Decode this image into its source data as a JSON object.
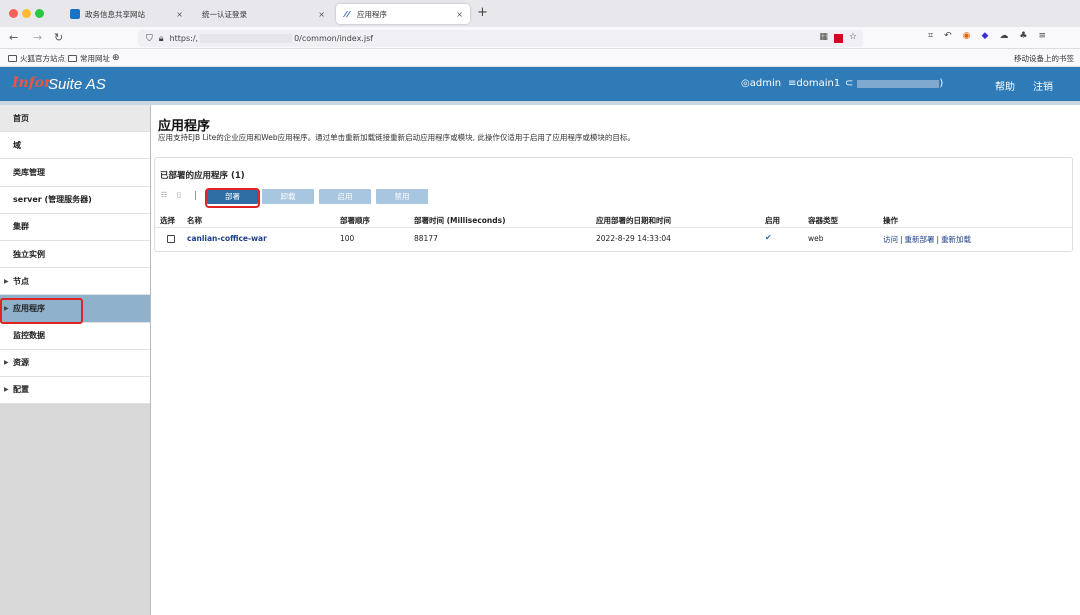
{
  "browser": {
    "tabs": [
      {
        "title": "政务信息共享网站",
        "close": "×"
      },
      {
        "title": "统一认证登录",
        "close": "×"
      },
      {
        "title": "应用程序",
        "close": "×"
      }
    ],
    "new_tab": "+",
    "url_prefix": "https:/,",
    "url_suffix": "0/common/index.jsf",
    "bookmarks": [
      "火狐官方站点",
      "常用网址"
    ],
    "mobile_bookmarks": "移动设备上的书签"
  },
  "header": {
    "logo_infor": "Infor",
    "logo_suite": "Suite AS",
    "user": "admin",
    "domain": "domain1",
    "ip_suffix": ")",
    "help": "帮助",
    "logout": "注销"
  },
  "sidebar": {
    "items": [
      {
        "label": "首页",
        "arrow": false
      },
      {
        "label": "域",
        "arrow": false
      },
      {
        "label": "类库管理",
        "arrow": false
      },
      {
        "label": "server (管理服务器)",
        "arrow": false
      },
      {
        "label": "集群",
        "arrow": false
      },
      {
        "label": "独立实例",
        "arrow": false
      },
      {
        "label": "节点",
        "arrow": true
      },
      {
        "label": "应用程序",
        "arrow": true
      },
      {
        "label": "监控数据",
        "arrow": false
      },
      {
        "label": "资源",
        "arrow": true
      },
      {
        "label": "配置",
        "arrow": true
      }
    ]
  },
  "main": {
    "title": "应用程序",
    "description": "应用支持EJB Lite的企业应用和Web应用程序。通过单击重新加载链接重新启动应用程序或模块, 此操作仅适用于启用了应用程序或模块的目标。",
    "panel_title": "已部署的应用程序 (1)",
    "buttons": {
      "deploy": "部署",
      "undeploy": "卸载",
      "enable": "启用",
      "disable": "禁用"
    },
    "table": {
      "headers": [
        "选择",
        "名称",
        "部署顺序",
        "部署时间 (Milliseconds)",
        "应用部署的日期和时间",
        "启用",
        "容器类型",
        "操作"
      ],
      "rows": [
        {
          "name": "canlian-coffice-war",
          "order": "100",
          "deploy_time": "88177",
          "datetime": "2022-8-29 14:33:04",
          "enabled": "✔",
          "container": "web",
          "actions": [
            "访问",
            "重新部署",
            "重新加载"
          ]
        }
      ]
    }
  },
  "colors": {
    "header_bg": "#2e7bb7",
    "primary_button": "#2d6da3",
    "disabled_button": "#a8c6e0",
    "highlight_red": "#e02424",
    "sidebar_active": "#8fb1cc"
  }
}
